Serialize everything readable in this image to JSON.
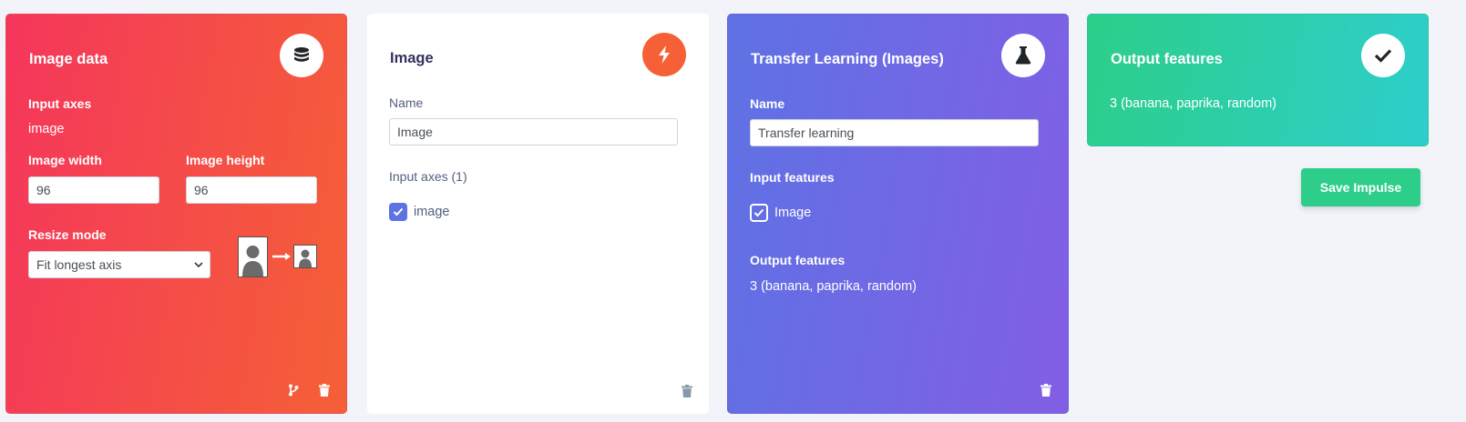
{
  "cards": {
    "image_data": {
      "title": "Image data",
      "icon": "database-icon",
      "input_axes_label": "Input axes",
      "input_axes_value": "image",
      "image_width_label": "Image width",
      "image_width_value": "96",
      "image_height_label": "Image height",
      "image_height_value": "96",
      "resize_mode_label": "Resize mode",
      "resize_mode_value": "Fit longest axis",
      "colors": {
        "gradient_start": "#f5365c",
        "gradient_end": "#f56036"
      }
    },
    "image": {
      "title": "Image",
      "icon": "bolt-icon",
      "name_label": "Name",
      "name_value": "Image",
      "input_axes_label": "Input axes (1)",
      "axis_checkbox_label": "image",
      "axis_checked": true,
      "colors": {
        "accent": "#f56036",
        "checkbox": "#5e72e4"
      }
    },
    "transfer_learning": {
      "title": "Transfer Learning (Images)",
      "icon": "flask-icon",
      "name_label": "Name",
      "name_value": "Transfer learning",
      "input_features_label": "Input features",
      "input_feature_checkbox_label": "Image",
      "input_feature_checked": true,
      "output_features_label": "Output features",
      "output_features_value": "3 (banana, paprika, random)",
      "colors": {
        "gradient_start": "#5e72e4",
        "gradient_end": "#825ee4"
      }
    },
    "output_features": {
      "title": "Output features",
      "icon": "check-icon",
      "value": "3 (banana, paprika, random)",
      "colors": {
        "gradient_start": "#2dce89",
        "gradient_end": "#2dcecc"
      }
    }
  },
  "actions": {
    "save_impulse_label": "Save Impulse"
  }
}
